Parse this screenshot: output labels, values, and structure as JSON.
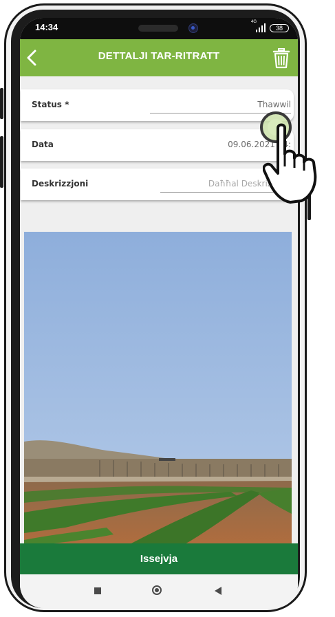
{
  "status_bar": {
    "time": "14:34",
    "network": "4G",
    "battery": "38"
  },
  "app_bar": {
    "title": "DETTALJI TAR-RITRATT",
    "back_icon": "chevron-left-icon",
    "delete_icon": "trash-icon"
  },
  "fields": [
    {
      "label": "Status *",
      "value": "Thawwil",
      "is_placeholder": false
    },
    {
      "label": "Data",
      "value": "09.06.2021 14:",
      "is_placeholder": false
    },
    {
      "label": "Deskrizzjoni",
      "value": "Daħħal Deskrizzjoni",
      "is_placeholder": true
    }
  ],
  "photo": {
    "subject": "field-landscape",
    "sky_color": "#9fbde3",
    "soil_color": "#a4683f",
    "plant_color": "#3f7a2a"
  },
  "action": {
    "label": "Issejvja"
  },
  "nav_bar": {
    "icons": [
      "recents-square-icon",
      "home-circle-icon",
      "back-triangle-icon"
    ]
  },
  "colors": {
    "app_bar": "#7fb542",
    "action_bar": "#1a7a3b",
    "background": "#efefef"
  }
}
